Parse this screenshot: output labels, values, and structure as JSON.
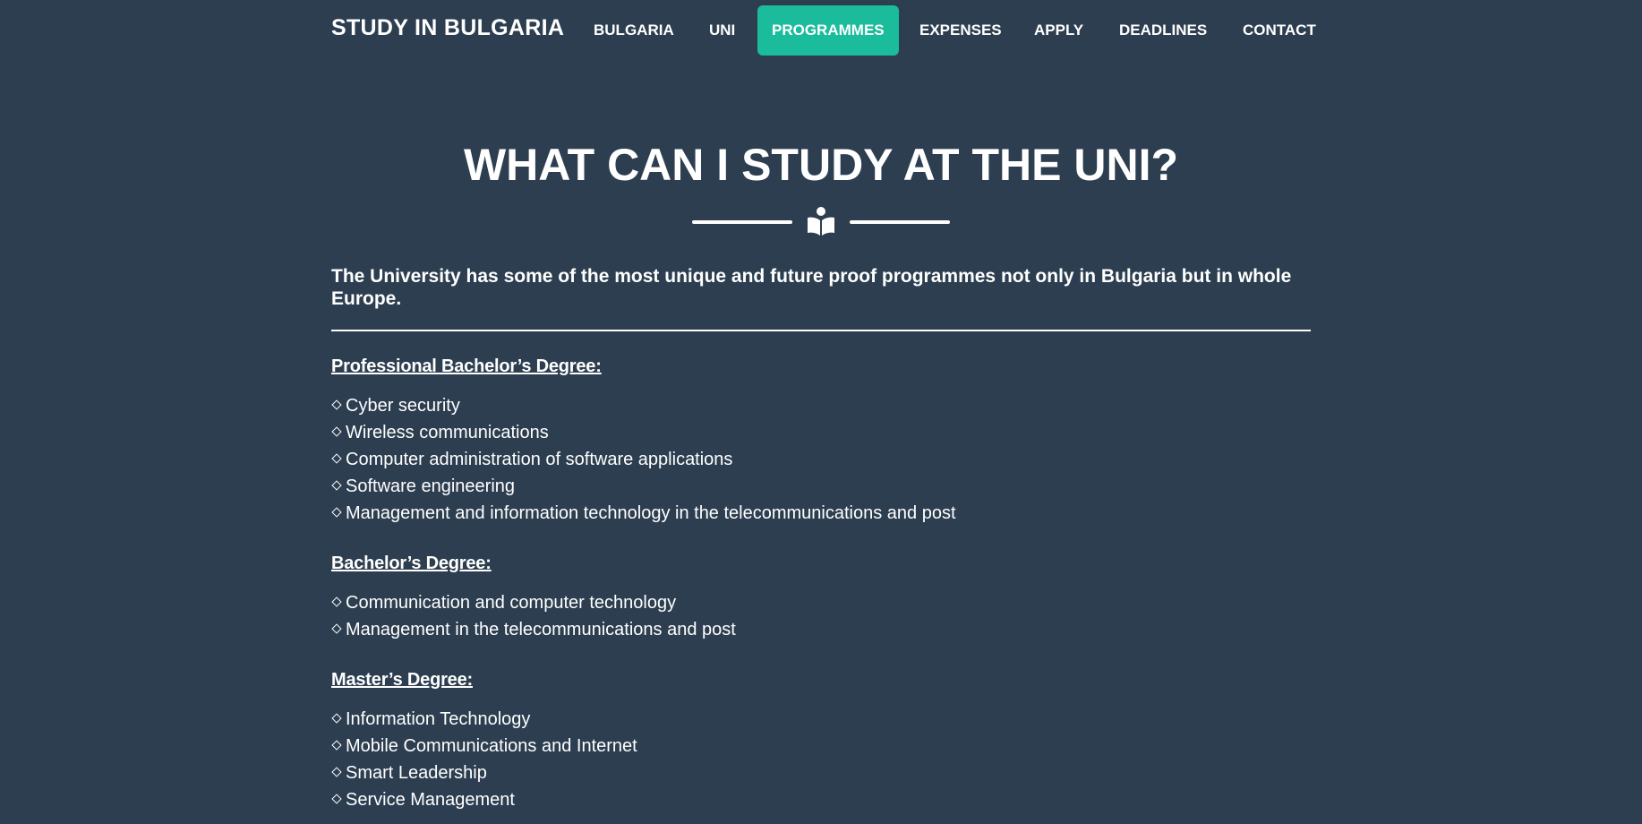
{
  "nav": {
    "brand": "STUDY IN BULGARIA",
    "items": [
      {
        "label": "BULGARIA",
        "active": false
      },
      {
        "label": "UNI",
        "active": false
      },
      {
        "label": "PROGRAMMES",
        "active": true
      },
      {
        "label": "EXPENSES",
        "active": false
      },
      {
        "label": "APPLY",
        "active": false
      },
      {
        "label": "DEADLINES",
        "active": false
      },
      {
        "label": "CONTACT",
        "active": false
      }
    ]
  },
  "page": {
    "title": "WHAT CAN I STUDY AT THE UNI?",
    "divider_icon": "book-open-reader-icon",
    "lead": "The University has some of the most unique and future proof programmes not only in Bulgaria but in whole Europe."
  },
  "sections": [
    {
      "heading": "Professional Bachelor’s Degree:",
      "items": [
        "Cyber security",
        "Wireless communications",
        "Computer administration of software applications",
        "Software engineering",
        "Management and information technology in the telecommunications and post"
      ]
    },
    {
      "heading": "Bachelor’s Degree:",
      "items": [
        "Communication and computer technology",
        "Management in the telecommunications and post"
      ]
    },
    {
      "heading": "Master’s Degree:",
      "items": [
        "Information Technology",
        "Mobile Communications and Internet",
        "Smart Leadership",
        "Service Management"
      ]
    }
  ],
  "colors": {
    "background": "#2c3e50",
    "accent": "#1abc9c",
    "text": "#ffffff"
  }
}
